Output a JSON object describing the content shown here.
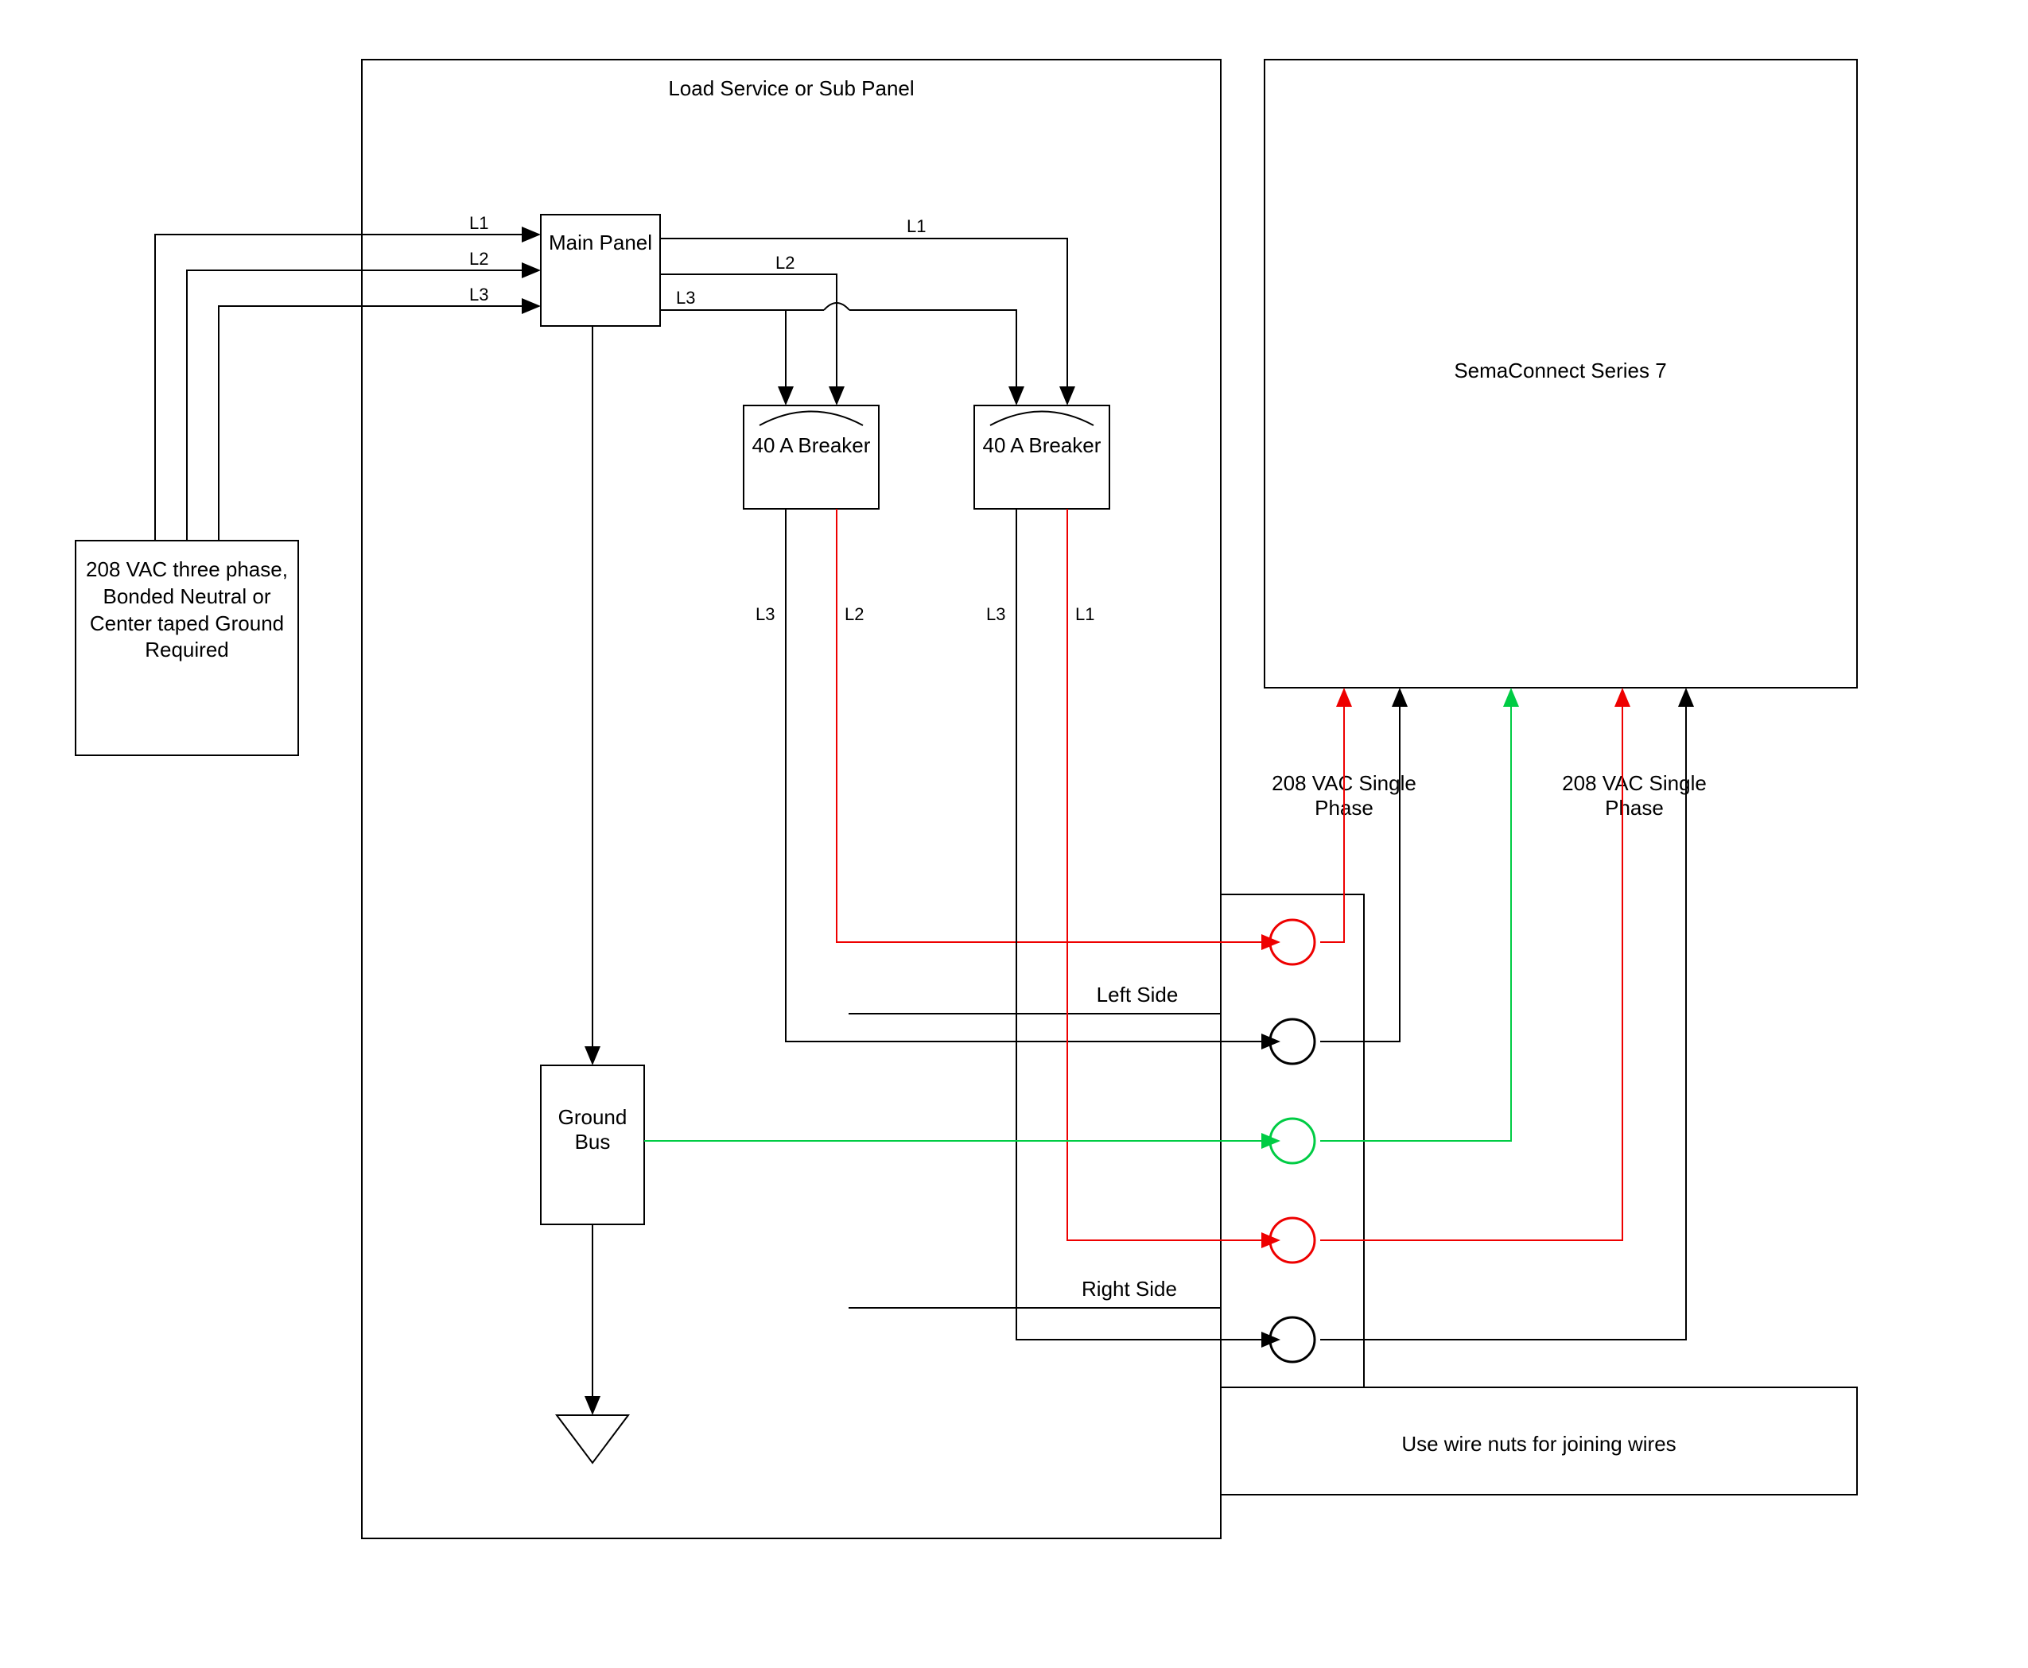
{
  "panel_title": "Load Service or Sub Panel",
  "source_box": "208 VAC three phase, Bonded Neutral or Center taped Ground Required",
  "main_panel": "Main Panel",
  "breaker1": "40 A Breaker",
  "breaker2": "40 A Breaker",
  "ground_bus": "Ground Bus",
  "device": "SemaConnect Series 7",
  "left_side": "Left Side",
  "right_side": "Right Side",
  "vac_label_left": "208 VAC Single Phase",
  "vac_label_right": "208 VAC Single Phase",
  "note": "Use wire nuts for joining wires",
  "l1": "L1",
  "l2": "L2",
  "l3": "L3",
  "b1_l3": "L3",
  "b1_l2": "L2",
  "b2_l3": "L3",
  "b2_l1": "L1"
}
